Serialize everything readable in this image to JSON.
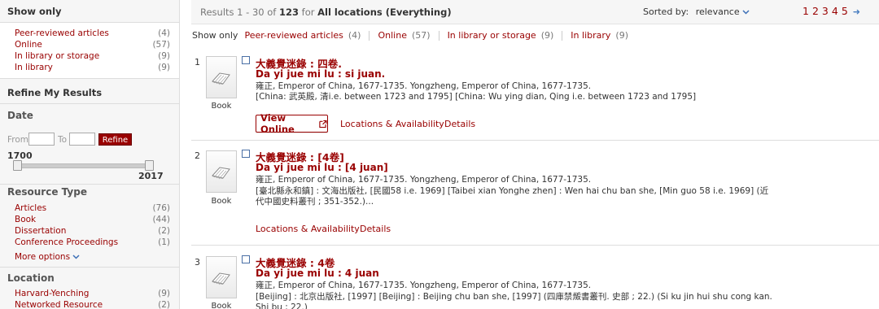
{
  "sidebar": {
    "show_only_title": "Show only",
    "show_only": [
      {
        "label": "Peer-reviewed articles",
        "count": "(4)"
      },
      {
        "label": "Online",
        "count": "(57)"
      },
      {
        "label": "In library or storage",
        "count": "(9)"
      },
      {
        "label": "In library",
        "count": "(9)"
      }
    ],
    "refine_title": "Refine My Results",
    "date": {
      "title": "Date",
      "from_label": "From",
      "to_label": "To",
      "refine_label": "Refine",
      "min": "1700",
      "max": "2017"
    },
    "resource_type": {
      "title": "Resource Type",
      "items": [
        {
          "label": "Articles",
          "count": "(76)"
        },
        {
          "label": "Book",
          "count": "(44)"
        },
        {
          "label": "Dissertation",
          "count": "(2)"
        },
        {
          "label": "Conference Proceedings",
          "count": "(1)"
        }
      ],
      "more_label": "More options"
    },
    "location": {
      "title": "Location",
      "items": [
        {
          "label": "Harvard-Yenching",
          "count": "(9)"
        },
        {
          "label": "Networked Resource",
          "count": "(2)"
        }
      ]
    }
  },
  "header": {
    "results_prefix": "Results 1 - 30 of",
    "results_total": "123",
    "results_for": "for",
    "scope": "All locations (Everything)",
    "sorted_by_label": "Sorted by:",
    "sorted_value": "relevance",
    "pages": [
      "1",
      "2",
      "3",
      "4",
      "5"
    ]
  },
  "filter_bar": {
    "label": "Show only",
    "items": [
      {
        "label": "Peer-reviewed articles",
        "count": "(4)"
      },
      {
        "label": "Online",
        "count": "(57)"
      },
      {
        "label": "In library or storage",
        "count": "(9)"
      },
      {
        "label": "In library",
        "count": "(9)"
      }
    ]
  },
  "results": [
    {
      "num": "1",
      "format": "Book",
      "title_zh": "大義覺迷錄 : 四卷.",
      "title_en": "Da yi jue mi lu : si juan.",
      "author": "雍正, Emperor of China, 1677-1735. Yongzheng, Emperor of China, 1677-1735.",
      "pub1": "[China: 武英殿, 清i.e. between 1723 and 1795] [China: Wu ying dian, Qing i.e. between 1723 and 1795]",
      "pub2": "",
      "view_online": "View Online",
      "actions": [
        "Locations & Availability",
        "Details"
      ]
    },
    {
      "num": "2",
      "format": "Book",
      "title_zh": "大義覺迷錄 : [4卷]",
      "title_en": "Da yi jue mi lu : [4 juan]",
      "author": "雍正, Emperor of China, 1677-1735. Yongzheng, Emperor of China, 1677-1735.",
      "pub1": "[臺北縣永和鎮] : 文海出版社, [民國58 i.e. 1969] [Taibei xian Yonghe zhen] : Wen hai chu ban she, [Min guo 58 i.e. 1969] (近",
      "pub2": "代中國史料叢刊 ; 351-352.)...",
      "actions": [
        "Locations & Availability",
        "Details"
      ]
    },
    {
      "num": "3",
      "format": "Book",
      "title_zh": "大義覺迷錄 : 4卷",
      "title_en": "Da yi jue mi lu : 4 juan",
      "author": "雍正, Emperor of China, 1677-1735. Yongzheng, Emperor of China, 1677-1735.",
      "pub1": "[Beijing] : 北京出版社, [1997] [Beijing] : Beijing chu ban she, [1997] (四庫禁燬書叢刊. 史部 ; 22.) (Si ku jin hui shu cong kan.",
      "pub2": "Shi bu ; 22.)"
    }
  ]
}
